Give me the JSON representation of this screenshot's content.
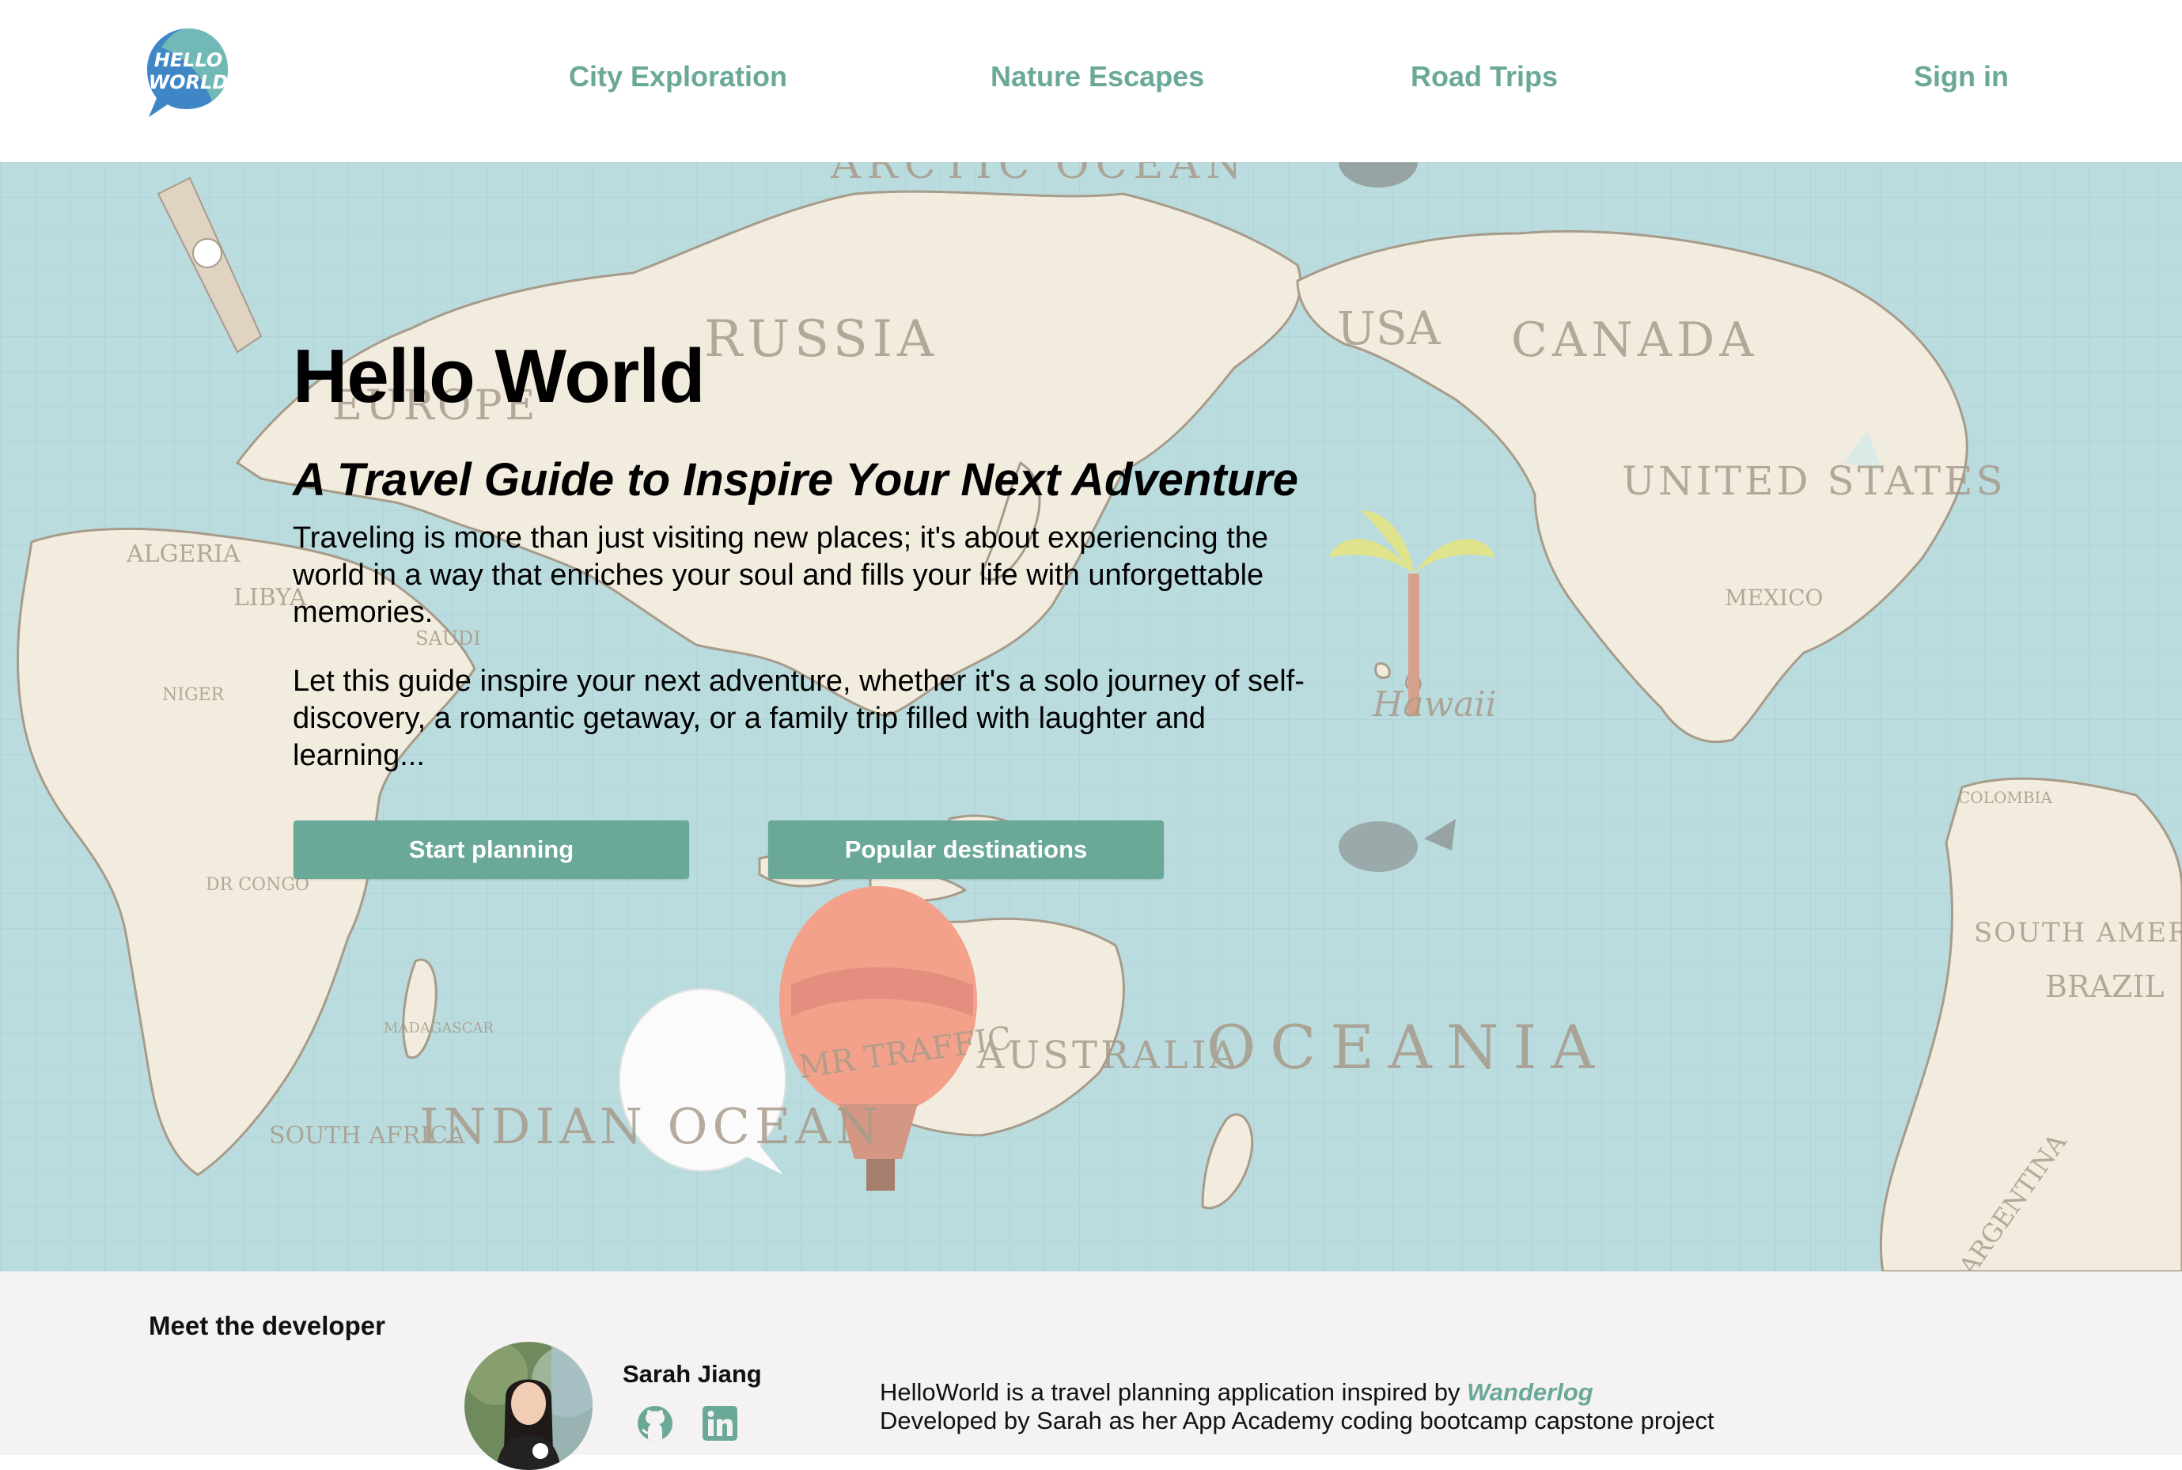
{
  "nav": {
    "logo_text_line1": "HELLO",
    "logo_text_line2": "WORLD",
    "links": [
      "City Exploration",
      "Nature Escapes",
      "Road Trips"
    ],
    "sign_in": "Sign in"
  },
  "hero": {
    "title": "Hello World",
    "subtitle": "A Travel Guide to Inspire Your Next Adventure",
    "paragraph1": "Traveling is more than just visiting new places; it's about experiencing the world in a way that enriches your soul and fills your life with unforgettable memories.",
    "paragraph2": "Let this guide inspire your next adventure, whether it's a solo journey of self-discovery, a romantic getaway, or a family trip filled with laughter and learning...",
    "buttons": {
      "start": "Start planning",
      "popular": "Popular destinations"
    },
    "map_labels": {
      "arctic": "ARCTIC OCEAN",
      "russia": "RUSSIA",
      "europe": "EUROPE",
      "usa": "USA",
      "canada": "CANADA",
      "united_states": "UNITED STATES",
      "mexico": "MEXICO",
      "hawaii": "Hawaii",
      "algeria": "ALGERIA",
      "libya": "LIBYA",
      "saudi": "SAUDI",
      "niger": "NIGER",
      "dr_congo": "DR CONGO",
      "madagascar": "MADAGASCAR",
      "south_africa": "SOUTH AFRICA",
      "indian": "INDIAN OCEAN",
      "australia": "AUSTRALIA",
      "oceania": "OCEANIA",
      "colombia": "COLOMBIA",
      "south_america": "SOUTH AMERICA",
      "brazil": "BRAZIL",
      "argentina": "ARGENTINA",
      "balloon": "MR TRAFFIC"
    }
  },
  "footer": {
    "heading": "Meet the developer",
    "developer_name": "Sarah Jiang",
    "about_prefix": "HelloWorld is a travel planning application inspired by ",
    "about_link": "Wanderlog",
    "about_line2": "Developed by Sarah as her App Academy coding bootcamp capstone project"
  },
  "colors": {
    "accent": "#6aa898",
    "ocean": "#a7d3d7",
    "land": "#efe7d6",
    "footer_bg": "#f4f2f2"
  }
}
